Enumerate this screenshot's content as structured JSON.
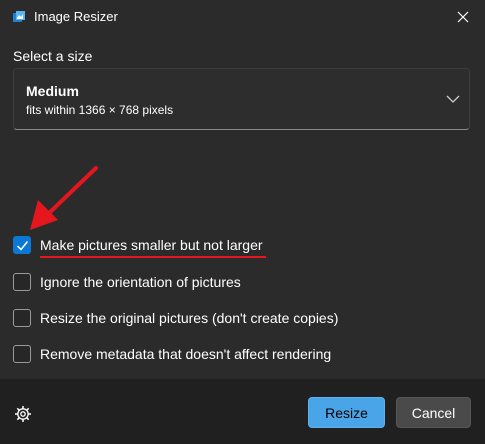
{
  "window": {
    "title": "Image Resizer",
    "icon": "image-resizer-app-icon",
    "close_icon": "close-icon"
  },
  "size": {
    "section_label": "Select a size",
    "selected_name": "Medium",
    "selected_description": "fits within 1366 × 768 pixels",
    "dropdown_icon": "chevron-down-icon"
  },
  "options": [
    {
      "label": "Make pictures smaller but not larger",
      "checked": true
    },
    {
      "label": "Ignore the orientation of pictures",
      "checked": false
    },
    {
      "label": "Resize the original pictures (don't create copies)",
      "checked": false
    },
    {
      "label": "Remove metadata that doesn't affect rendering",
      "checked": false
    }
  ],
  "footer": {
    "settings_icon": "gear-icon",
    "resize_label": "Resize",
    "cancel_label": "Cancel"
  },
  "annotation": {
    "arrow_icon": "red-arrow-icon",
    "color": "#e4161e"
  },
  "colors": {
    "accent": "#0a78d4",
    "primary_button": "#4aa4e8",
    "background": "#2b2b2b",
    "footer_background": "#202020"
  }
}
